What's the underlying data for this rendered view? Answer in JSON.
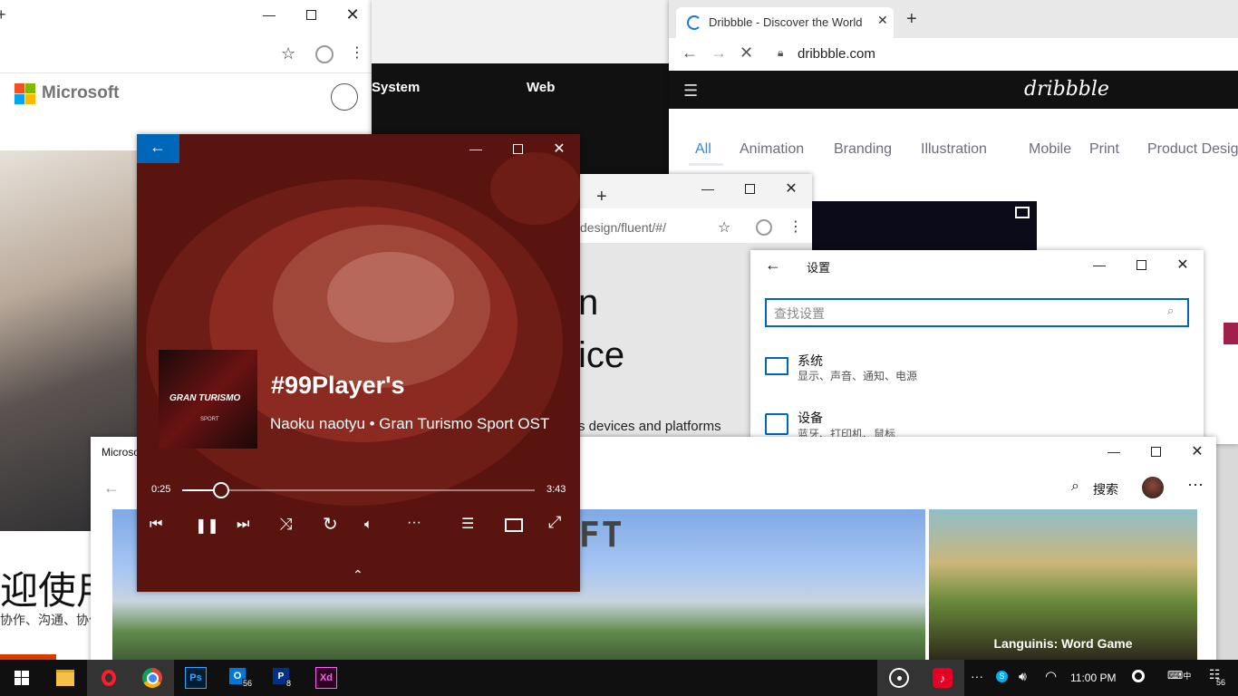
{
  "ms_window": {
    "brand": "Microsoft",
    "heading_partial": "迎使用",
    "sub_partial": "协作、沟通、协作"
  },
  "middle_window": {
    "nav": [
      "System",
      "Web"
    ]
  },
  "dribbble": {
    "tab_title": "Dribbble - Discover the World",
    "url": "dribbble.com",
    "logo": "dribbble",
    "categories": [
      "All",
      "Animation",
      "Branding",
      "Illustration",
      "Mobile",
      "Print",
      "Product Desig"
    ]
  },
  "fluent": {
    "url": "design/fluent/#/",
    "heading1": "n",
    "heading2": "ice",
    "subtitle": "s devices and platforms"
  },
  "settings": {
    "title": "设置",
    "search_placeholder": "查找设置",
    "items": [
      {
        "name": "系统",
        "desc": "显示、声音、通知、电源"
      },
      {
        "name": "设备",
        "desc": "蓝牙、打印机、鼠标"
      }
    ]
  },
  "store": {
    "title": "Microso",
    "search_label": "搜索",
    "tile_title": "Languinis: Word Game",
    "banner_text": "AFT"
  },
  "player": {
    "track_title": "#99Player's",
    "track_subtitle": "Naoku naotyu • Gran Turismo Sport OST",
    "cover_line1": "GRAN TURISMO",
    "cover_line2": "SPORT",
    "elapsed": "0:25",
    "duration": "3:43",
    "progress": 0.11
  },
  "taskbar": {
    "time": "11:00 PM",
    "outlook_badge": "56",
    "ps_badge": "8",
    "notif_badge": "56",
    "ps_label": "Ps",
    "xd_label": "Xd",
    "ime": "中"
  },
  "colors": {
    "player_bg": "#5a1410",
    "accent_blue": "#0067b8",
    "ms_red": "#f25022",
    "ms_green": "#7fba00",
    "ms_blue": "#00a4ef",
    "ms_yellow": "#ffb900"
  }
}
